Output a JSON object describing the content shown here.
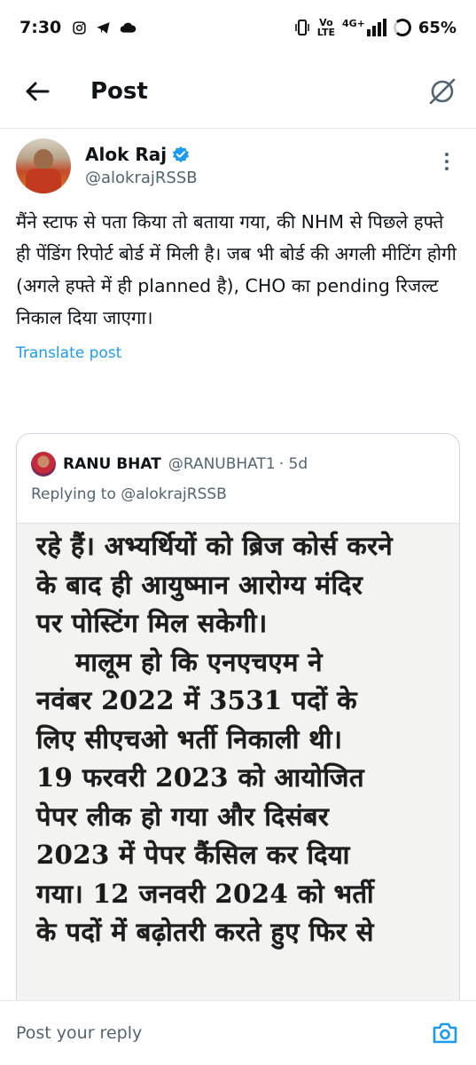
{
  "status_bar": {
    "time": "7:30",
    "volte_top": "Vo",
    "volte_bottom": "LTE",
    "network": "4G+",
    "battery": "65%"
  },
  "header": {
    "title": "Post"
  },
  "post": {
    "author_name": "Alok Raj",
    "author_handle": "@alokrajRSSB",
    "text": "मैंने स्टाफ से पता किया तो बताया गया, की NHM से पिछले हफ्ते ही पेंडिंग रिपोर्ट बोर्ड में मिली है। जब भी बोर्ड की अगली मीटिंग होगी (अगले हफ्ते में ही planned है), CHO का pending रिजल्ट निकाल दिया जाएगा।",
    "translate_label": "Translate post"
  },
  "quote": {
    "author_name": "RANU BHAT",
    "author_handle": "@RANUBHAT1",
    "time": "· 5d",
    "replying_prefix": "Replying to ",
    "replying_to": "@alokrajRSSB",
    "image_lines": [
      "रहे हैं। अभ्यर्थियों को ब्रिज कोर्स करने",
      "के बाद ही आयुष्मान आरोग्य मंदिर",
      "पर पोस्टिंग मिल सकेगी।",
      "मालूम हो कि एनएचएम ने",
      "नवंबर 2022 में 3531 पदों के",
      "लिए सीएचओ भर्ती निकाली थी।",
      "19 फरवरी 2023 को आयोजित",
      "पेपर लीक हो गया और दिसंबर",
      "2023 में पेपर कैंसिल कर दिया",
      "गया। 12 जनवरी 2024 को भर्ती",
      "के पदों में बढ़ोतरी करते हुए फिर से"
    ]
  },
  "reply": {
    "placeholder": "Post your reply"
  },
  "colors": {
    "accent": "#1d9bf0",
    "text": "#0f1419",
    "muted": "#536471"
  }
}
